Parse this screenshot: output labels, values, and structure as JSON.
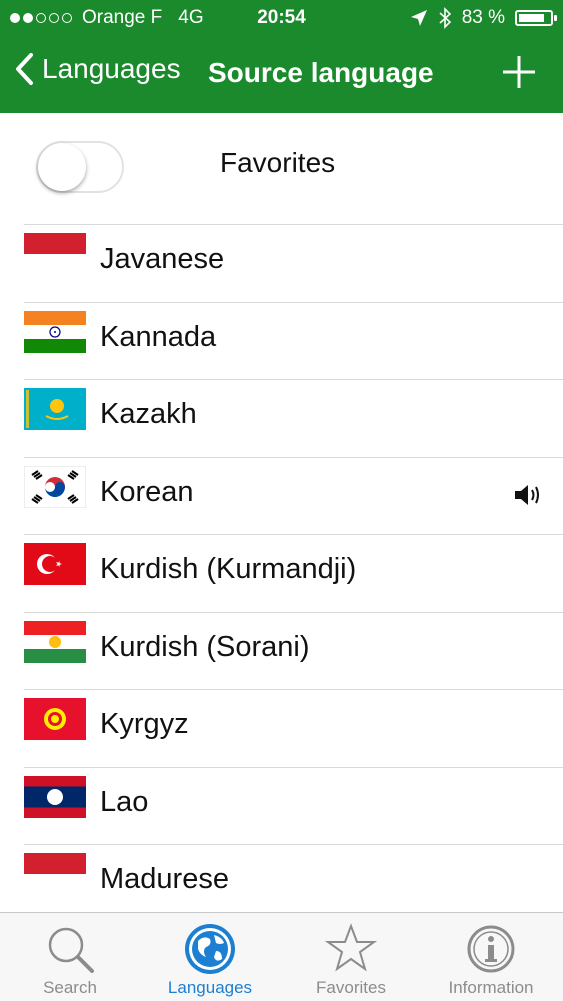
{
  "status_bar": {
    "carrier": "Orange F",
    "network": "4G",
    "time": "20:54",
    "battery": "83 %",
    "battery_level": 0.83
  },
  "nav": {
    "back_label": "Languages",
    "title": "Source language",
    "add_icon": "plus-icon"
  },
  "favorites": {
    "label": "Favorites",
    "toggle_on": false
  },
  "languages": [
    {
      "name": "Javanese",
      "flag": "javanese-flag",
      "speaker": false
    },
    {
      "name": "Kannada",
      "flag": "india-flag",
      "speaker": false
    },
    {
      "name": "Kazakh",
      "flag": "kazakhstan-flag",
      "speaker": false
    },
    {
      "name": "Korean",
      "flag": "south-korea-flag",
      "speaker": true
    },
    {
      "name": "Kurdish (Kurmandji)",
      "flag": "turkey-flag",
      "speaker": false
    },
    {
      "name": "Kurdish (Sorani)",
      "flag": "kurdistan-flag",
      "speaker": false
    },
    {
      "name": "Kyrgyz",
      "flag": "kyrgyzstan-flag",
      "speaker": false
    },
    {
      "name": "Lao",
      "flag": "laos-flag",
      "speaker": false
    },
    {
      "name": "Madurese",
      "flag": "madurese-flag",
      "speaker": false
    }
  ],
  "tabs": [
    {
      "label": "Search",
      "icon": "magnifier-icon",
      "active": false
    },
    {
      "label": "Languages",
      "icon": "globe-icon",
      "active": true
    },
    {
      "label": "Favorites",
      "icon": "star-icon",
      "active": false
    },
    {
      "label": "Information",
      "icon": "info-icon",
      "active": false
    }
  ],
  "colors": {
    "header_green": "#1b8a2d",
    "tab_active_blue": "#1d7fd1",
    "tab_inactive_gray": "#8c8c8c"
  }
}
